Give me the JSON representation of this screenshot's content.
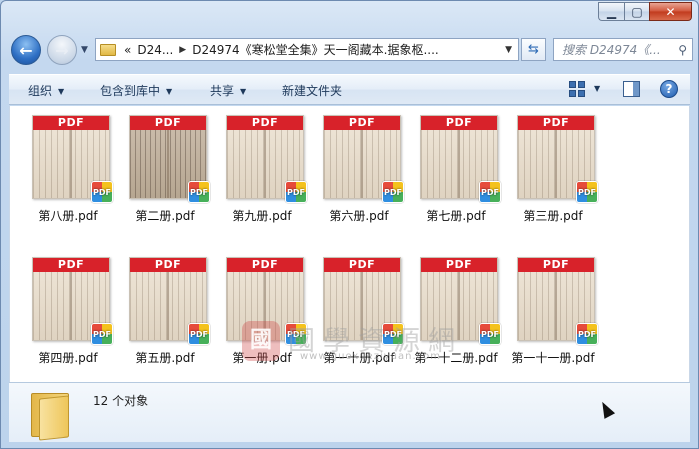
{
  "window": {
    "caption": {
      "minimize": "▁",
      "maximize": "▢",
      "close": "✕"
    }
  },
  "address": {
    "crumbs": [
      "D24...",
      "D24974《寒松堂全集》天一阁藏本.据象枢...."
    ],
    "history_prefix": "«"
  },
  "search": {
    "placeholder": "搜索 D24974《..."
  },
  "toolbar": {
    "organize": "组织",
    "include_in_library": "包含到库中",
    "share": "共享",
    "new_folder": "新建文件夹"
  },
  "files": [
    {
      "name": "第八册.pdf",
      "band": "PDF",
      "badge": "PDF"
    },
    {
      "name": "第二册.pdf",
      "band": "PDF",
      "badge": "PDF"
    },
    {
      "name": "第九册.pdf",
      "band": "PDF",
      "badge": "PDF"
    },
    {
      "name": "第六册.pdf",
      "band": "PDF",
      "badge": "PDF"
    },
    {
      "name": "第七册.pdf",
      "band": "PDF",
      "badge": "PDF"
    },
    {
      "name": "第三册.pdf",
      "band": "PDF",
      "badge": "PDF"
    },
    {
      "name": "第四册.pdf",
      "band": "PDF",
      "badge": "PDF"
    },
    {
      "name": "第五册.pdf",
      "band": "PDF",
      "badge": "PDF"
    },
    {
      "name": "第一册.pdf",
      "band": "PDF",
      "badge": "PDF"
    },
    {
      "name": "第一十册.pdf",
      "band": "PDF",
      "badge": "PDF"
    },
    {
      "name": "第一十二册.pdf",
      "band": "PDF",
      "badge": "PDF"
    },
    {
      "name": "第一十一册.pdf",
      "band": "PDF",
      "badge": "PDF"
    }
  ],
  "watermark": {
    "title": "國學資源網",
    "url": "www.guoxueziyuan.com"
  },
  "status": {
    "count": "12 个对象"
  },
  "colors": {
    "pdf_band": "#d8222a",
    "window_frame": "#bcd3ec"
  }
}
